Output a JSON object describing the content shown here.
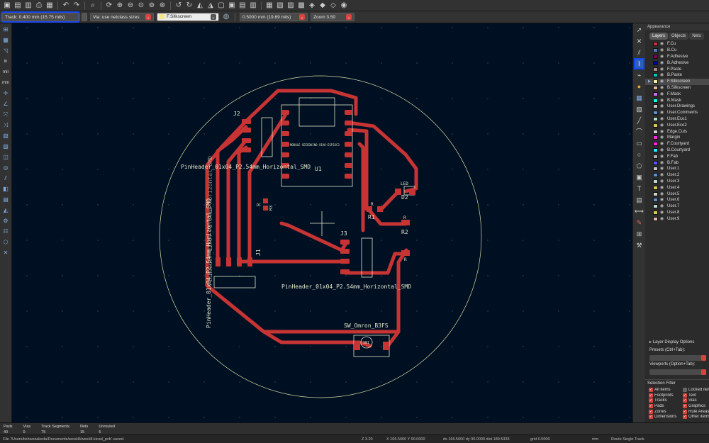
{
  "toolbar": {
    "icons": [
      "save-icon",
      "open-icon",
      "page-setup-icon",
      "print-icon",
      "plot-icon",
      "undo-icon",
      "redo-icon",
      "search-icon",
      "refresh-icon",
      "zoom-in-icon",
      "zoom-out-icon",
      "zoom-fit-icon",
      "zoom-objects-icon",
      "zoom-selection-icon",
      "rotate-ccw-icon",
      "rotate-cw-icon",
      "flip-icon",
      "mirror-icon",
      "group-icon",
      "lock-icon",
      "unlock-icon",
      "align-icon",
      "footprint-editor-icon",
      "footprint-browser-icon",
      "netlist-icon",
      "update-pcb-icon",
      "drc-icon",
      "3d-viewer-icon",
      "scripting-icon",
      "plugin-icon"
    ]
  },
  "toolbar2": {
    "track": "Track: 0.400 mm (15.75 mils)",
    "via": "Via: use netclass sizes",
    "layer": "F.Silkscreen",
    "grid": "0.5000 mm (19.69 mils)",
    "zoom": "Zoom 3.50",
    "layer_color": "#f2e68a"
  },
  "left_tools": [
    "grid-icon",
    "ruler-icon",
    "polar-icon",
    "inches-label",
    "mils-label",
    "millimeters-label",
    "cursor-icon",
    "measure-icon",
    "ratsnest-icon",
    "curved-ratsnest-icon",
    "zone-fill-icon",
    "zone-outline-icon",
    "pad-outline-icon",
    "via-outline-icon",
    "track-outline-icon",
    "high-contrast-icon",
    "layers-manager-icon",
    "footprint-wizard-icon",
    "inspector-icon",
    "net-inspector-icon",
    "3d-icon",
    "scripting-icon"
  ],
  "left_labels": {
    "in": "in",
    "mil": "mil",
    "mm": "mm"
  },
  "right_tools": [
    "select-arrow-icon",
    "highlight-net-icon",
    "route-track-icon",
    "route-diff-pair-icon",
    "tune-length-icon",
    "add-footprint-icon",
    "add-via-icon",
    "add-zone-icon",
    "add-rule-area-icon",
    "draw-line-icon",
    "draw-arc-icon",
    "draw-rectangle-icon",
    "draw-circle-icon",
    "draw-polygon-icon",
    "add-image-icon",
    "add-text-icon",
    "add-textbox-icon",
    "add-dimension-icon",
    "delete-icon",
    "set-origin-icon",
    "grid-origin-icon",
    "interactive-router-settings-icon"
  ],
  "appearance": {
    "title": "Appearance",
    "tabs": [
      "Layers",
      "Objects",
      "Nets"
    ],
    "layers": [
      {
        "name": "F.Cu",
        "color": "#c83434"
      },
      {
        "name": "B.Cu",
        "color": "#4d7fc4"
      },
      {
        "name": "F.Adhesive",
        "color": "#84004e"
      },
      {
        "name": "B.Adhesive",
        "color": "#0000a0"
      },
      {
        "name": "F.Paste",
        "color": "#b48787"
      },
      {
        "name": "B.Paste",
        "color": "#00c2c2"
      },
      {
        "name": "F.Silkscreen",
        "color": "#f2eda1"
      },
      {
        "name": "B.Silkscreen",
        "color": "#e8b2a7"
      },
      {
        "name": "F.Mask",
        "color": "#d864ff"
      },
      {
        "name": "B.Mask",
        "color": "#02ffee"
      },
      {
        "name": "User.Drawings",
        "color": "#c2c2c2"
      },
      {
        "name": "User.Comments",
        "color": "#5994dc"
      },
      {
        "name": "User.Eco1",
        "color": "#b4dbd2"
      },
      {
        "name": "User.Eco2",
        "color": "#d8c852"
      },
      {
        "name": "Edge.Cuts",
        "color": "#d0d2cd"
      },
      {
        "name": "Margin",
        "color": "#ff26e2"
      },
      {
        "name": "F.Courtyard",
        "color": "#ff26e2"
      },
      {
        "name": "B.Courtyard",
        "color": "#26e9ff"
      },
      {
        "name": "F.Fab",
        "color": "#afafaf"
      },
      {
        "name": "B.Fab",
        "color": "#5858ff"
      },
      {
        "name": "User.1",
        "color": "#c2c2c2"
      },
      {
        "name": "User.2",
        "color": "#5994dc"
      },
      {
        "name": "User.3",
        "color": "#b4dbd2"
      },
      {
        "name": "User.4",
        "color": "#d8c852"
      },
      {
        "name": "User.5",
        "color": "#d0d2cd"
      },
      {
        "name": "User.6",
        "color": "#5994dc"
      },
      {
        "name": "User.7",
        "color": "#b4dbd2"
      },
      {
        "name": "User.8",
        "color": "#d8c852"
      },
      {
        "name": "User.9",
        "color": "#e8b2a7"
      }
    ],
    "selected_layer": "F.Silkscreen",
    "layer_display_options": "Layer Display Options",
    "presets_label": "Presets (Ctrl+Tab):",
    "viewports_label": "Viewports (Option+Tab):"
  },
  "selection_filter": {
    "title": "Selection Filter",
    "items": [
      {
        "label": "All items",
        "checked": true
      },
      {
        "label": "Locked items",
        "checked": false
      },
      {
        "label": "Footprints",
        "checked": true
      },
      {
        "label": "Text",
        "checked": true
      },
      {
        "label": "Tracks",
        "checked": true
      },
      {
        "label": "Vias",
        "checked": true
      },
      {
        "label": "Pads",
        "checked": true
      },
      {
        "label": "Graphics",
        "checked": true
      },
      {
        "label": "Zones",
        "checked": true
      },
      {
        "label": "Rule Areas",
        "checked": true
      },
      {
        "label": "Dimensions",
        "checked": true
      },
      {
        "label": "Other items",
        "checked": true
      }
    ]
  },
  "board": {
    "labels": {
      "j2_ref": "J2",
      "j2_value": "PinHeader_01x04_P2.54mm_Horizontal_SMD",
      "j1_ref": "J1",
      "j1_value": "PinHeader_01x04_P2.54mm_Horizontal_SMD",
      "j1_value_ghost": "PinHeader_01x04_P2.54mm_Horizontal_SMD",
      "j3_ref": "J3",
      "j3_value": "PinHeader_01x04_P2.54mm_Horizontal_SMD",
      "u1_ref": "U1",
      "u1_value": "MODULE-SEEEDUINO-XIAO-ESP32C3",
      "r3_ref": "R3",
      "r3_value": "DC",
      "r1_ref": "R1",
      "r1_value": "R",
      "r2_ref": "R2",
      "r2_value": "R",
      "r4_value": "R",
      "d2_ref": "D2",
      "d2_value": "LED",
      "sw_ref": "SW1",
      "sw_value": "SW_Omron_B3FS"
    }
  },
  "messages": {
    "columns": [
      {
        "label": "Pads",
        "value": "40"
      },
      {
        "label": "Vias",
        "value": "0"
      },
      {
        "label": "Track Segments",
        "value": "75"
      },
      {
        "label": "Nets",
        "value": "15"
      },
      {
        "label": "Unrouted",
        "value": "5"
      }
    ]
  },
  "status": {
    "file": "File '/Users/bsharutakeda/Documents/week8/week8.kicad_pcb' saved.",
    "z": "Z 3.20",
    "xy": "X 166.5000  Y 90.0000",
    "dxdy": "dx 166.5000  dy 90.0000  dist 189.5333",
    "grid": "grid 0.5000",
    "units": "mm",
    "mode": "Route Single Track"
  }
}
